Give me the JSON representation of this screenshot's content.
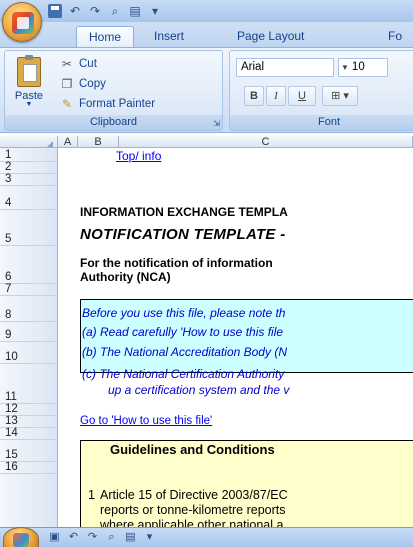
{
  "tabs": [
    "Home",
    "Insert",
    "Page Layout",
    "Fo"
  ],
  "ribbon": {
    "clipboard": {
      "paste_label": "Paste",
      "cut_label": "Cut",
      "copy_label": "Copy",
      "format_painter_label": "Format Painter",
      "group_label": "Clipboard"
    },
    "font": {
      "font_name": "Arial",
      "font_size": "10",
      "bold_label": "B",
      "italic_label": "I",
      "underline_label": "U",
      "group_label": "Font"
    }
  },
  "columns": [
    "A",
    "B",
    "C"
  ],
  "rows": [
    "1",
    "2",
    "3",
    "4",
    "5",
    "6",
    "7",
    "8",
    "9",
    "10",
    "11",
    "12",
    "13",
    "14",
    "15",
    "16"
  ],
  "cells": {
    "top_info_link": "Top/ info",
    "exchange_title": "INFORMATION EXCHANGE TEMPLA",
    "notification_title": "NOTIFICATION TEMPLATE  -",
    "notification_text_1": "For the notification of information",
    "notification_text_2": "Authority (NCA)",
    "note_line_1": "Before you use this file, please note th",
    "note_line_2": "(a)  Read carefully 'How to use this file",
    "note_line_3": "(b)  The National Accreditation Body (N",
    "note_line_4": "(c)  The National Certification Authority",
    "note_line_5": "up a certification system and the v",
    "how_to_link": "Go to 'How to use this file'",
    "guidelines_title": "Guidelines and Conditions",
    "guideline_num": "1",
    "guideline_line_1": "Article 15 of Directive 2003/87/EC",
    "guideline_line_2": "reports or tonne-kilometre reports",
    "guideline_line_3": "where applicable other national a"
  },
  "colors": {
    "link": "#0000ff",
    "notice_box": "#ccffff",
    "guidelines_box": "#ffffcc",
    "ribbon_text": "#15428b"
  }
}
